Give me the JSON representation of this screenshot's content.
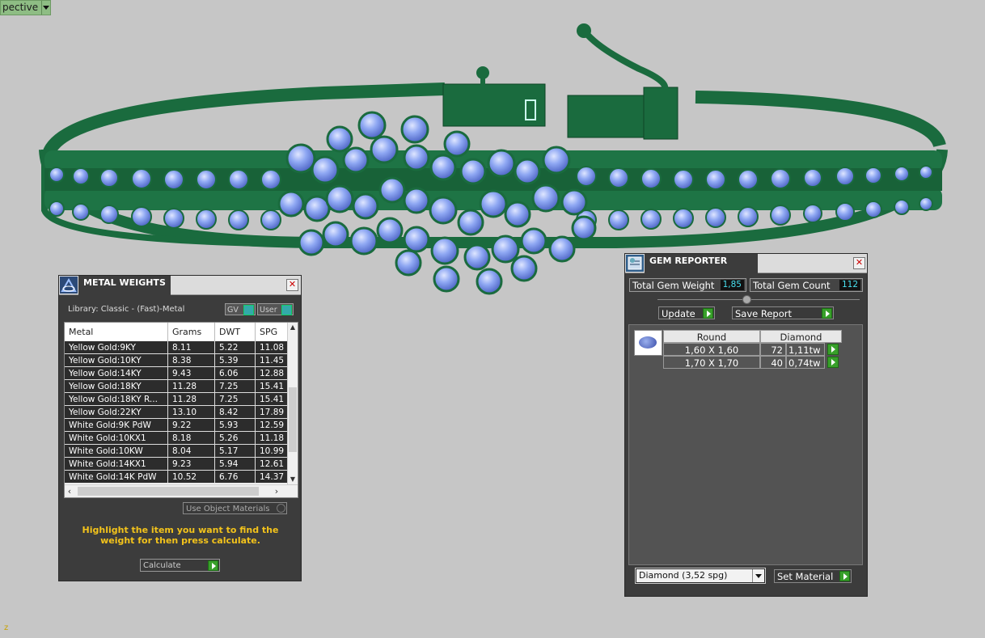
{
  "viewport": {
    "view_mode": "pective",
    "axis_label": "z"
  },
  "metal_weights": {
    "title": "METAL WEIGHTS",
    "library_label": "Library: Classic - (Fast)-Metal",
    "gv_label": "GV",
    "user_label": "User",
    "columns": [
      "Metal",
      "Grams",
      "DWT",
      "SPG"
    ],
    "rows": [
      [
        "Yellow Gold:9KY",
        "8.11",
        "5.22",
        "11.08"
      ],
      [
        "Yellow Gold:10KY",
        "8.38",
        "5.39",
        "11.45"
      ],
      [
        "Yellow Gold:14KY",
        "9.43",
        "6.06",
        "12.88"
      ],
      [
        "Yellow Gold:18KY",
        "11.28",
        "7.25",
        "15.41"
      ],
      [
        "Yellow Gold:18KY R...",
        "11.28",
        "7.25",
        "15.41"
      ],
      [
        "Yellow Gold:22KY",
        "13.10",
        "8.42",
        "17.89"
      ],
      [
        "White Gold:9K PdW",
        "9.22",
        "5.93",
        "12.59"
      ],
      [
        "White Gold:10KX1",
        "8.18",
        "5.26",
        "11.18"
      ],
      [
        "White Gold:10KW",
        "8.04",
        "5.17",
        "10.99"
      ],
      [
        "White Gold:14KX1",
        "9.23",
        "5.94",
        "12.61"
      ],
      [
        "White Gold:14K PdW",
        "10.52",
        "6.76",
        "14.37"
      ]
    ],
    "use_object_materials": "Use Object Materials",
    "hint": "Highlight the item you want to find the weight for then press calculate.",
    "calculate_label": "Calculate"
  },
  "gem_reporter": {
    "title": "GEM REPORTER",
    "total_weight_label": "Total Gem Weight",
    "total_weight_value": "1,85",
    "total_count_label": "Total Gem Count",
    "total_count_value": "112",
    "update_label": "Update",
    "save_report_label": "Save Report",
    "columns": [
      "Round",
      "Diamond"
    ],
    "rows": [
      {
        "size": "1,60 X 1,60",
        "count": "72",
        "weight": "1,11tw"
      },
      {
        "size": "1,70 X 1,70",
        "count": "40",
        "weight": "0,74tw"
      }
    ],
    "material_select": "Diamond    (3,52 spg)",
    "set_material_label": "Set Material"
  }
}
